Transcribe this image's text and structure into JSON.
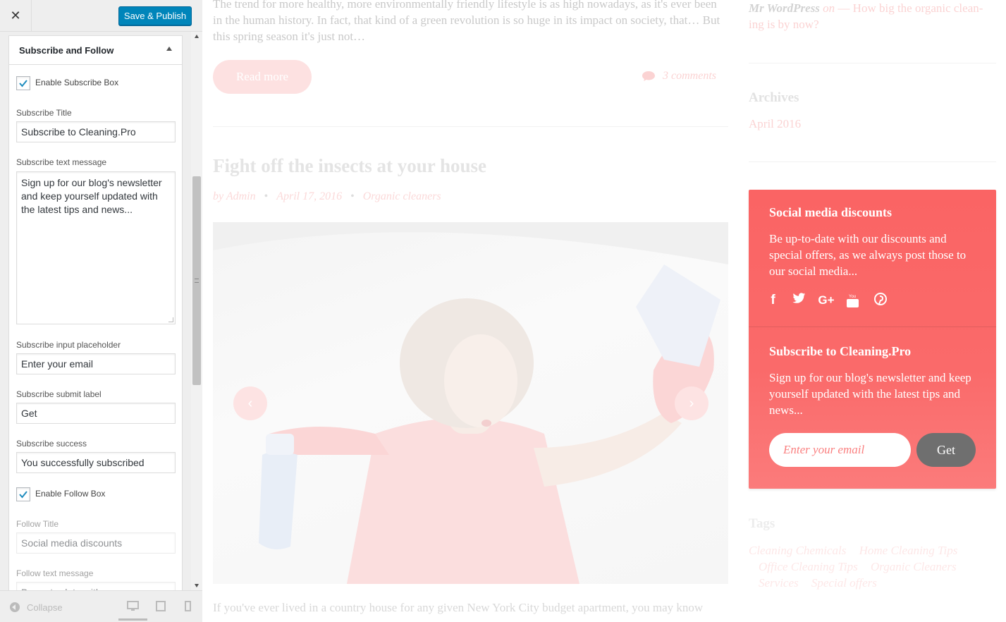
{
  "customizer": {
    "publish_label": "Save & Publish",
    "section_title": "Subscribe and Follow",
    "enable_subscribe_label": "Enable Subscribe Box",
    "subscribe_title_label": "Subscribe Title",
    "subscribe_title_value": "Subscribe to Cleaning.Pro",
    "subscribe_text_label": "Subscribe text message",
    "subscribe_text_value": "Sign up for our blog's newsletter and keep yourself updated with the latest tips and news...",
    "placeholder_label": "Subscribe input placeholder",
    "placeholder_value": "Enter your email",
    "submit_label_label": "Subscribe submit label",
    "submit_label_value": "Get",
    "success_label": "Subscribe success",
    "success_value": "You successfully subscribed",
    "enable_follow_label": "Enable Follow Box",
    "follow_title_label": "Follow Title",
    "follow_title_value": "Social media discounts",
    "follow_text_label": "Follow text message",
    "follow_text_value": "Be up-to-date with our",
    "collapse_label": "Collapse"
  },
  "preview": {
    "excerpt": "The trend for more healthy, more environmentally friendly lifestyle is as high nowadays, as it's ever been in the human history. In fact, that kind of a green revolution is so huge in its impact on society, that… But this spring season it's just not…",
    "read_more": "Read more",
    "comments": "3 comments",
    "post_title": "Fight off the insects at your house",
    "post_author": "by Admin",
    "post_date": "April 17, 2016",
    "post_category": "Organic cleaners",
    "bottom_text": "If you've ever lived in a country house for any given New York City budget apartment, you may know",
    "recent_comment_author": "Mr WordPress",
    "recent_comment_on": "on",
    "recent_comment_post": "How big the organic clean-ing is by now?",
    "archives_title": "Archives",
    "archives_item": "April 2016",
    "social_title": "Social media discounts",
    "social_text": "Be up-to-date with our discounts and special offers, as we always post those to our social media...",
    "subscribe_title": "Subscribe to Cleaning.Pro",
    "subscribe_text": "Sign up for our blog's newsletter and keep yourself updated with the latest tips and news...",
    "email_placeholder": "Enter your email",
    "get_label": "Get",
    "tags_title": "Tags",
    "tags": [
      "Cleaning Chemicals",
      "Home Cleaning Tips",
      "Office Cleaning Tips",
      "Organic Cleaners",
      "Services",
      "Special offers"
    ],
    "social_icons": [
      "facebook-icon",
      "twitter-icon",
      "google-plus-icon",
      "youtube-icon",
      "pinterest-icon"
    ],
    "colors": {
      "accent": "#fa6464",
      "publish": "#0085ba",
      "get_button": "#6f6f6f"
    }
  }
}
